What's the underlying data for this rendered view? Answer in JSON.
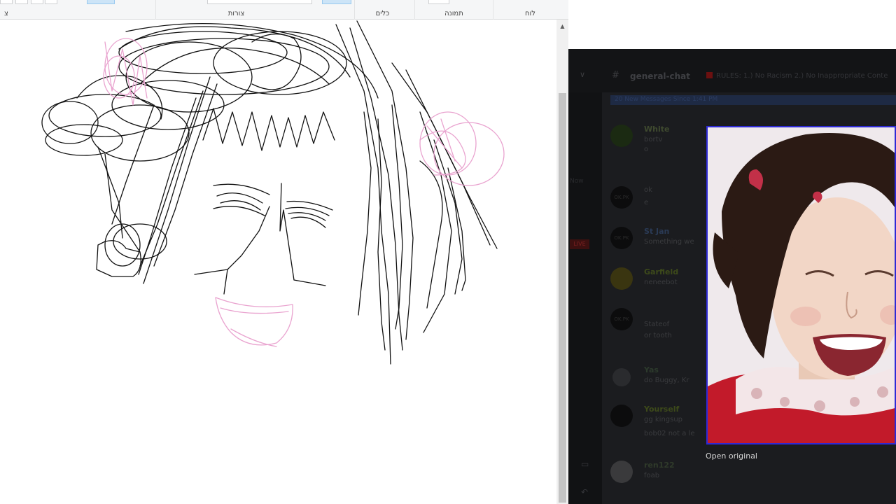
{
  "ribbon": {
    "groups": [
      {
        "label": "לוח"
      },
      {
        "label": "תמונה"
      },
      {
        "label": "כלים"
      },
      {
        "label": "צורות"
      },
      {
        "label": "צ"
      }
    ]
  },
  "chat": {
    "channel_name": "general-chat",
    "topic": "RULES: 1.) No Racism 2.) No Inappropriate Conte",
    "new_messages": "20 New Messages Since 1:41 PM",
    "rail_labels": [
      "Now",
      "LIVE"
    ],
    "messages": [
      {
        "author": "White",
        "author_color": "#3f4a2f",
        "content": "bortv",
        "content2": "o"
      },
      {
        "author": "",
        "author_color": "#3a3b3e",
        "content": "ok",
        "content2": "e"
      },
      {
        "author": "St Jan",
        "author_color": "#3a3b3e",
        "content": "Something we",
        "content2": ""
      },
      {
        "author": "Garfield",
        "author_color": "#3d4a1a",
        "content": "neneebot",
        "content2": ""
      },
      {
        "author": "",
        "author_color": "#3a3b3e",
        "content": "Stateof",
        "content2": "or tooth"
      },
      {
        "author": "Yas",
        "author_color": "#2c3a2c",
        "content": "do Buggy, Kr",
        "content2": ""
      },
      {
        "author": "Yourself",
        "author_color": "#3d4a1a",
        "content": "gg kingsup",
        "content2": "bob02 not a le"
      },
      {
        "author": "ren122",
        "author_color": "#2f3a2a",
        "content": "foab",
        "content2": ""
      }
    ],
    "avatar_text": "OK.PK",
    "open_original": "Open original"
  },
  "colors": {
    "ribbon_bg": "#f5f6f7",
    "chat_bg": "#1b1c1f",
    "preview_border": "#2e2ad6",
    "pencil_black": "#111111",
    "pencil_pink": "#e9a3cf"
  },
  "icons": {
    "scroll_up": "▲",
    "hash": "#",
    "chevron": "∨",
    "monitor": "▭",
    "phone": "↶"
  }
}
